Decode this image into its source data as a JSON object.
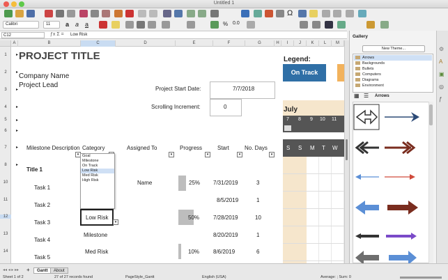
{
  "window": {
    "title": "Untitled 1"
  },
  "toolbar": {
    "font_name": "Calibri",
    "font_size": "11"
  },
  "formula_bar": {
    "cell_ref": "C12",
    "content": "Low Risk"
  },
  "columns": [
    "A",
    "B",
    "C",
    "D",
    "E",
    "F",
    "G",
    "H",
    "I",
    "J",
    "K",
    "L",
    "M"
  ],
  "rows": [
    "1",
    "2",
    "3",
    "4",
    "5",
    "6",
    "7",
    "8",
    "10",
    "11",
    "12",
    "13",
    "14"
  ],
  "sheet": {
    "project_title": "PROJECT TITLE",
    "company_name": "Company Name",
    "project_lead": "Project Lead",
    "start_date_label": "Project Start Date:",
    "start_date_value": "7/7/2018",
    "scroll_label": "Scrolling Increment:",
    "scroll_value": "0",
    "legend_label": "Legend:",
    "legend_status": "On Track",
    "month": "July",
    "day_numbers": [
      "7",
      "8",
      "9",
      "10",
      "11"
    ],
    "weekdays": [
      "S",
      "S",
      "M",
      "T",
      "W"
    ],
    "headers": {
      "milestone": "Milestone Description",
      "category": "Category",
      "assigned": "Assigned To",
      "progress": "Progress",
      "start": "Start",
      "days": "No. Days"
    },
    "tasks": [
      {
        "name": "Title 1",
        "category": "",
        "assigned": "",
        "progress": "",
        "start": "",
        "days": ""
      },
      {
        "name": "Task 1",
        "category": "",
        "assigned": "Name",
        "progress": "25%",
        "start": "7/31/2019",
        "days": "3"
      },
      {
        "name": "Task 2",
        "category": "",
        "assigned": "",
        "progress": "",
        "start": "8/5/2019",
        "days": "1"
      },
      {
        "name": "Task 3",
        "category": "Low Risk",
        "assigned": "",
        "progress": "50%",
        "start": "7/28/2019",
        "days": "10"
      },
      {
        "name": "Task 4",
        "category": "Milestone",
        "assigned": "",
        "progress": "",
        "start": "8/20/2019",
        "days": "1"
      },
      {
        "name": "Task 5",
        "category": "Med Risk",
        "assigned": "",
        "progress": "10%",
        "start": "8/6/2019",
        "days": "6"
      }
    ],
    "dropdown_options": [
      "Goal",
      "Milestone",
      "On Track",
      "Low Risk",
      "Med Risk",
      "High Risk"
    ],
    "progress_fractions": [
      0.25,
      0.5,
      0.1
    ]
  },
  "gallery": {
    "title": "Gallery",
    "new_theme": "New Theme...",
    "themes": [
      "Arrows",
      "Backgrounds",
      "Bullets",
      "Computers",
      "Diagrams",
      "Environment"
    ],
    "selected_theme": "Arrows",
    "colors": {
      "navy": "#2c4a77",
      "maroon": "#7a2d1f",
      "blue": "#5b8fd6",
      "red": "#d04a3a",
      "purple": "#7a4ac8",
      "gray": "#6e6e6e",
      "on_track": "#2f6fa6"
    }
  },
  "sheet_tabs": [
    "Gantt",
    "About"
  ],
  "status": {
    "sheet": "Sheet 1 of 2",
    "records": "27 of 27 records found",
    "page_style": "PageStyle_Gantt",
    "language": "English (USA)",
    "summary": "Average: ; Sum: 0"
  }
}
